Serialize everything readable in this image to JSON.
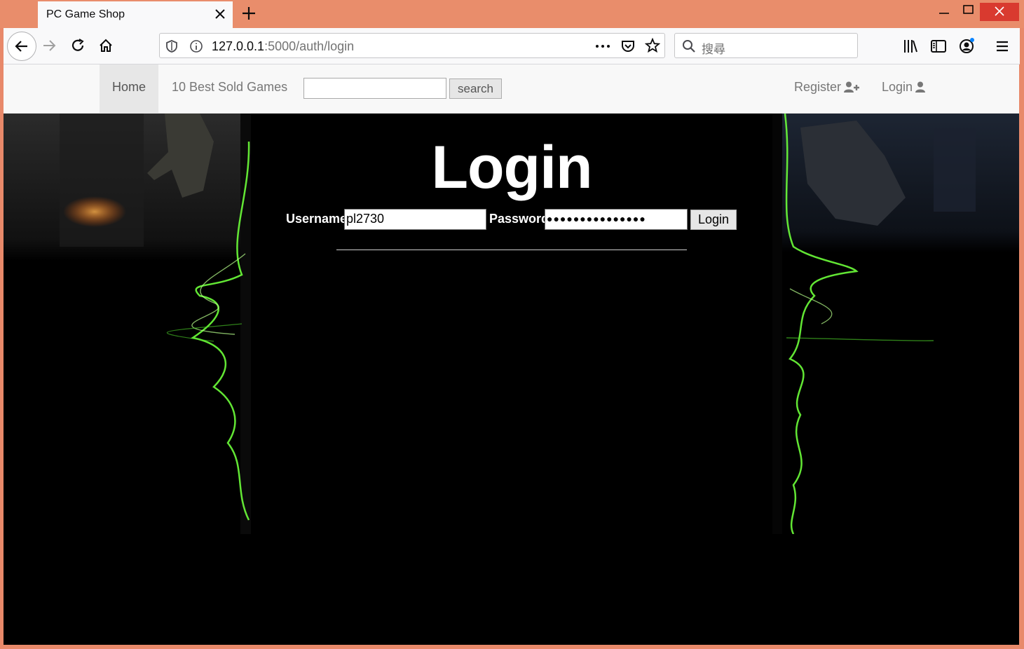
{
  "browser": {
    "tab_title": "PC Game Shop",
    "url_host": "127.0.0.1",
    "url_rest": ":5000/auth/login",
    "search_placeholder": "搜尋"
  },
  "site_nav": {
    "home": "Home",
    "best_sold": "10 Best Sold Games",
    "search_value": "",
    "search_button": "search",
    "register": "Register",
    "login": "Login"
  },
  "login_form": {
    "title": "Login",
    "username_label": "Username",
    "username_value": "pl2730",
    "password_label": "Password",
    "password_mask": "●●●●●●●●●●●●●●●",
    "submit": "Login"
  },
  "colors": {
    "window_frame": "#e98d6b",
    "page_background": "#000000",
    "neon_accent": "#6dff3a"
  }
}
